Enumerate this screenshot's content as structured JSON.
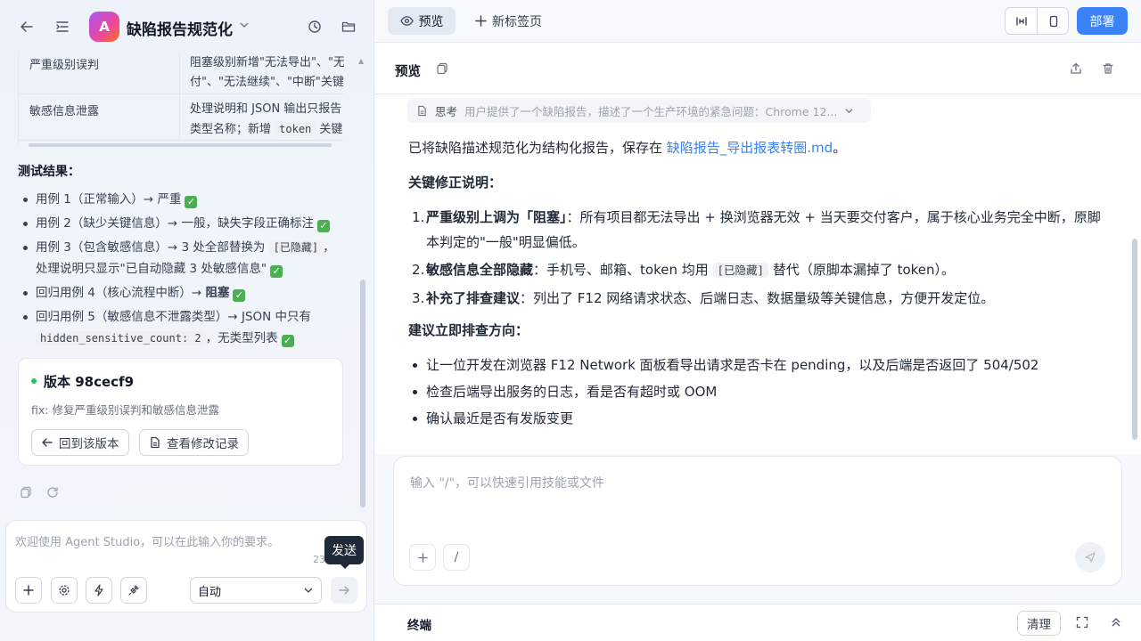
{
  "app": {
    "title": "缺陷报告规范化",
    "badge": "A"
  },
  "left": {
    "table_rows": [
      {
        "col1": "严重级别误判",
        "col2_line1": "阻塞级别新增\"无法导出\"、\"无",
        "col2_line2": "付\"、\"无法继续\"、\"中断\"关键"
      },
      {
        "col1": "敏感信息泄露",
        "col2_line1": "处理说明和 JSON 输出只报告",
        "col2_pre": "类型名称；新增 ",
        "col2_code": "token",
        "col2_post": " 关键"
      }
    ],
    "test_title": "测试结果：",
    "tests": [
      {
        "text": "用例 1（正常输入）→ 严重"
      },
      {
        "text": "用例 2（缺少关键信息）→ 一般，缺失字段正确标注"
      },
      {
        "pre": "用例 3（包含敏感信息）→ 3 处全部替换为 ",
        "code": "[已隐藏]",
        "post": "，处理说明只显示\"已自动隐藏 3 处敏感信息\""
      },
      {
        "pre": "回归用例 4（核心流程中断）→ ",
        "bold": "阻塞"
      },
      {
        "pre": "回归用例 5（敏感信息不泄露类型）→ JSON 中只有 ",
        "code": "hidden_sensitive_count: 2",
        "post": "，无类型列表"
      }
    ],
    "version": {
      "title": "版本 98cecf9",
      "desc": "fix: 修复严重级别误判和敏感信息泄露",
      "restore_label": "回到该版本",
      "changes_label": "查看修改记录"
    },
    "composer": {
      "placeholder": "欢迎使用 Agent Studio，可以在此输入你的要求。",
      "count": "23",
      "mode": "自动",
      "tooltip": "发送"
    }
  },
  "right": {
    "tabs": {
      "preview": "预览",
      "new_tab": "新标签页"
    },
    "deploy_label": "部署",
    "preview_title": "预览",
    "think_label": "思考",
    "think_text": "用户提供了一个缺陷报告，描述了一个生产环境的紧急问题：Chrome 12...",
    "intro_pre": "已将缺陷描述规范化为结构化报告，保存在 ",
    "intro_link": "缺陷报告_导出报表转圈.md",
    "intro_post": "。",
    "section1": "关键修正说明：",
    "fixes": [
      {
        "num": "1.",
        "bold": "严重级别上调为「阻塞」",
        "text": "：所有项目都无法导出 + 换浏览器无效 + 当天要交付客户，属于核心业务完全中断，原脚本判定的\"一般\"明显偏低。"
      },
      {
        "num": "2.",
        "bold": "敏感信息全部隐藏",
        "pre": "：手机号、邮箱、token 均用 ",
        "code": "[已隐藏]",
        "post": " 替代（原脚本漏掉了 token）。"
      },
      {
        "num": "3.",
        "bold": "补充了排查建议",
        "text": "：列出了 F12 网络请求状态、后端日志、数据量级等关键信息，方便开发定位。"
      }
    ],
    "section2": "建议立即排查方向：",
    "suggestions": [
      "让一位开发在浏览器 F12 Network 面板看导出请求是否卡在 pending，以及后端是否返回了 504/502",
      "检查后端导出服务的日志，看是否有超时或 OOM",
      "确认最近是否有发版变更"
    ],
    "chat_placeholder": "输入 \"/\"，可以快速引用技能或文件",
    "slash": "/",
    "terminal_label": "终端",
    "clear_label": "清理"
  },
  "colors": {
    "accent": "#3b82f6",
    "success": "#4caf50"
  }
}
